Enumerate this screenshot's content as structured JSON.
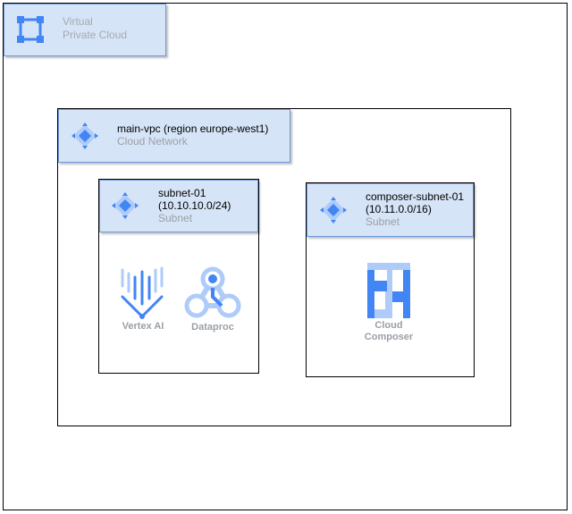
{
  "vpc_legend": {
    "line1": "Virtual",
    "line2": "Private Cloud",
    "icon": "vpc-frame-icon"
  },
  "main_vpc": {
    "title": "main-vpc (region europe-west1)",
    "subtitle": "Cloud Network",
    "icon": "network-diamond-icon"
  },
  "subnet1": {
    "title_line1": "subnet-01",
    "title_line2": "(10.10.10.0/24)",
    "subtitle": "Subnet",
    "icon": "network-diamond-icon",
    "services": [
      {
        "label": "Vertex AI",
        "icon": "vertex-ai-icon"
      },
      {
        "label": "Dataproc",
        "icon": "dataproc-icon"
      }
    ]
  },
  "subnet2": {
    "title_line1": "composer-subnet-01",
    "title_line2": "(10.11.0.0/16)",
    "subtitle": "Subnet",
    "icon": "network-diamond-icon",
    "services": [
      {
        "label_line1": "Cloud",
        "label_line2": "Composer",
        "icon": "cloud-composer-icon"
      }
    ]
  },
  "colors": {
    "header_fill": "#d6e4f7",
    "header_border": "#6f9be0",
    "icon_blue": "#4285f4",
    "icon_light": "#aecbfa"
  }
}
